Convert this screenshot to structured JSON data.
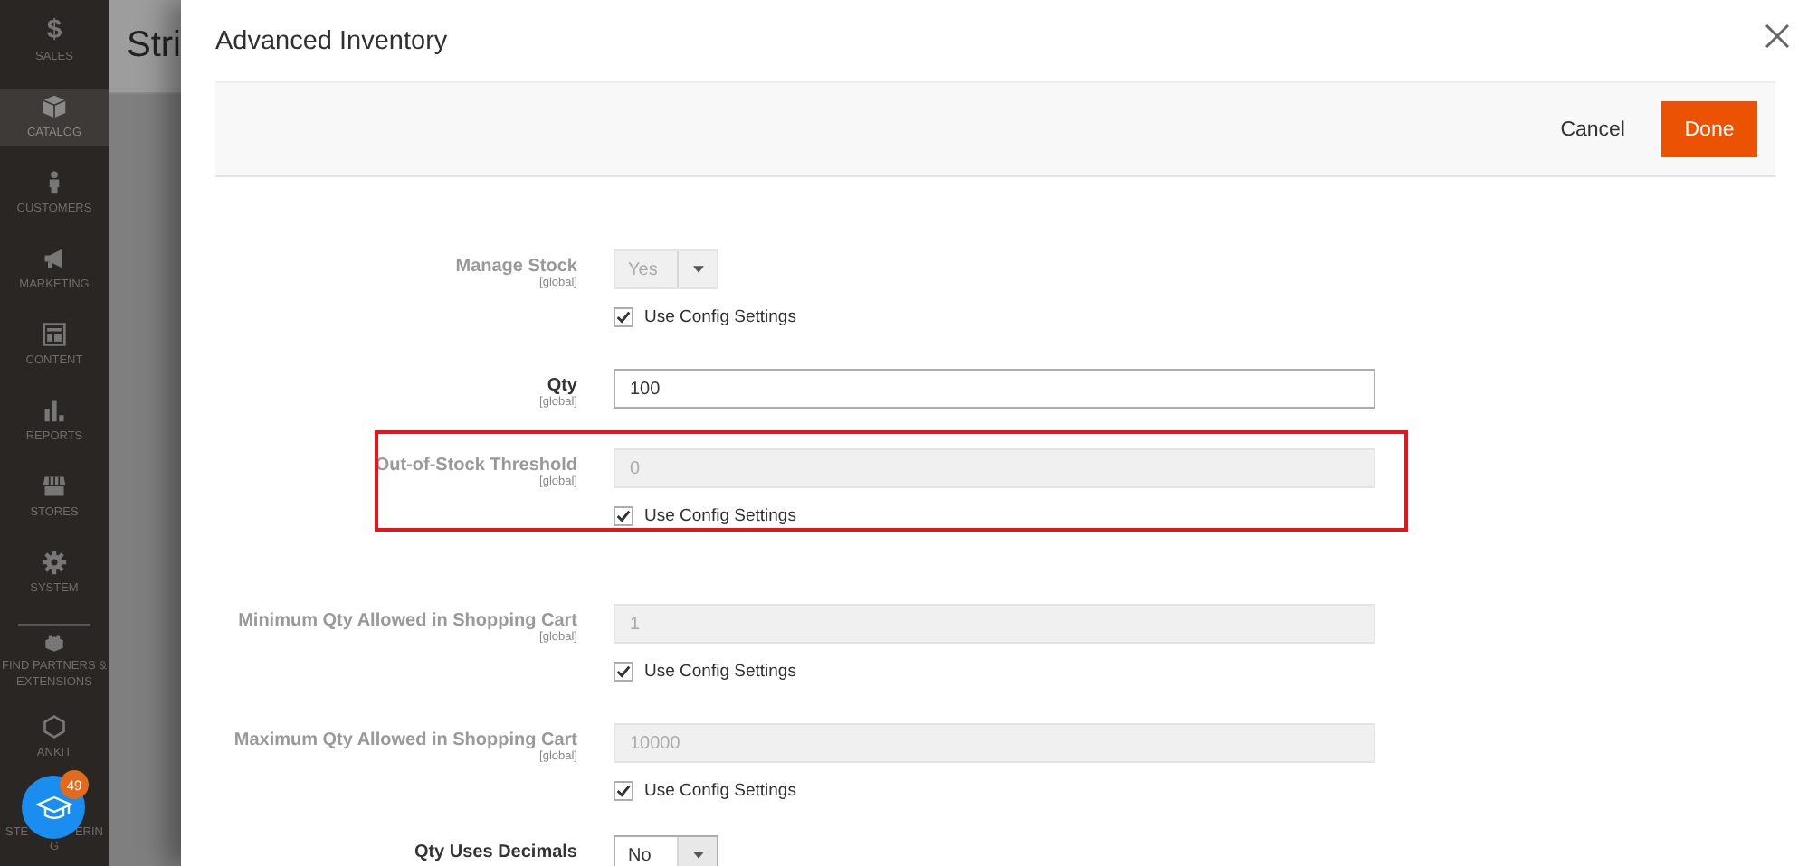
{
  "sidebar": {
    "items": [
      {
        "glyph": "$",
        "label": "SALES",
        "selected": false
      },
      {
        "label": "CATALOG",
        "selected": true
      },
      {
        "label": "CUSTOMERS",
        "selected": false
      },
      {
        "label": "MARKETING",
        "selected": false
      },
      {
        "label": "CONTENT",
        "selected": false
      },
      {
        "label": "REPORTS",
        "selected": false
      },
      {
        "label": "STORES",
        "selected": false
      },
      {
        "label": "SYSTEM",
        "selected": false
      },
      {
        "label": "FIND PARTNERS & EXTENSIONS",
        "selected": false
      },
      {
        "label": "ANKIT",
        "selected": false
      },
      {
        "label_parts": [
          "STE",
          "ERIN",
          "G"
        ],
        "selected": false
      }
    ],
    "help_button": {
      "badge": "49"
    }
  },
  "page": {
    "title": "Stri"
  },
  "modal": {
    "title": "Advanced Inventory",
    "actions": {
      "cancel": "Cancel",
      "done": "Done"
    },
    "rows": [
      {
        "label": "Manage Stock",
        "scope": "[global]",
        "kind": "select",
        "value": "Yes",
        "disabled": true,
        "use_config": {
          "label": "Use Config Settings",
          "checked": true
        }
      },
      {
        "label": "Qty",
        "scope": "[global]",
        "kind": "input",
        "value": "100",
        "disabled": false
      },
      {
        "label": "Out-of-Stock Threshold",
        "scope": "[global]",
        "kind": "input",
        "value": "0",
        "disabled": true,
        "highlighted": true,
        "use_config": {
          "label": "Use Config Settings",
          "checked": true
        }
      },
      {
        "label": "Minimum Qty Allowed in Shopping Cart",
        "scope": "[global]",
        "kind": "input",
        "value": "1",
        "disabled": true,
        "use_config": {
          "label": "Use Config Settings",
          "checked": true
        }
      },
      {
        "label": "Maximum Qty Allowed in Shopping Cart",
        "scope": "[global]",
        "kind": "input",
        "value": "10000",
        "disabled": true,
        "use_config": {
          "label": "Use Config Settings",
          "checked": true
        }
      },
      {
        "label": "Qty Uses Decimals",
        "kind": "select",
        "value": "No",
        "disabled": false
      }
    ]
  }
}
